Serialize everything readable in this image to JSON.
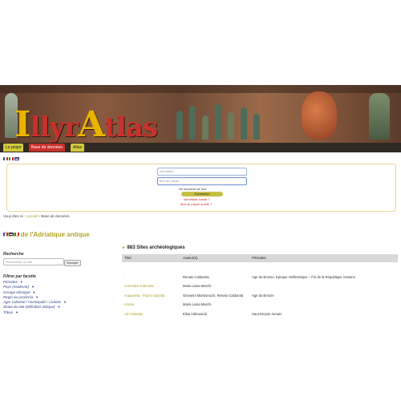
{
  "banner": {
    "title_part1": "I",
    "title_part2": "llyr",
    "title_part3": "A",
    "title_part4": "tlas"
  },
  "nav": {
    "tabs": [
      "Le projet",
      "Base de données",
      "Atlas"
    ]
  },
  "login": {
    "username_placeholder": "Identifiant",
    "password_placeholder": "Mot de passe",
    "remember_label": "Se souvenir de moi",
    "submit_label": "Connexion",
    "forgot_id": "Identifiant oublié ?",
    "forgot_pw": "Mot de passe oublié ?"
  },
  "breadcrumb": {
    "prefix": "Vous êtes ici :",
    "home": "Accueil",
    "sep": "›",
    "current": "Base de données"
  },
  "page_title": "Atlas de l'Adriatique antique",
  "search": {
    "heading": "Recherche",
    "placeholder": "Rechercher ce site",
    "button": "Envoyer"
  },
  "filters": {
    "heading": "Filtrer par facette",
    "items": [
      "Périodes",
      "Pays (moderne)",
      "Groupe ethnique",
      "Regio ou provincia",
      "Ager coloniae / municipalis / civitatis",
      "Statut du site (définition antique)",
      "Tribus"
    ]
  },
  "results": {
    "heading": "883 Sites archéologiques",
    "columns": [
      "Titre",
      "Auteur(s)",
      "Périodes"
    ],
    "rows": [
      {
        "title": "-",
        "author": "Renato Caldarola",
        "period": "Age du Bronze, Epoque Hellénistique – Fin de la République romaine"
      },
      {
        "title": "Acervaria Aufenoria",
        "author": "Maria Luisa Marchi",
        "period": ""
      },
      {
        "title": "Acquaviva - Pozzo Sacrato",
        "author": "Giovanni Mastronuzzi, Renato Caldarola",
        "period": "Age du Bronze"
      },
      {
        "title": "Acona",
        "author": "Maria Luisa Marchi",
        "period": ""
      },
      {
        "title": "Ad Calardas",
        "author": "Elisa Aldrovandi",
        "period": "Haut-Empire romain"
      }
    ]
  },
  "colors": {
    "accent": "#b2a52a",
    "red": "#c9302c",
    "navbar": "#2f2a23"
  }
}
